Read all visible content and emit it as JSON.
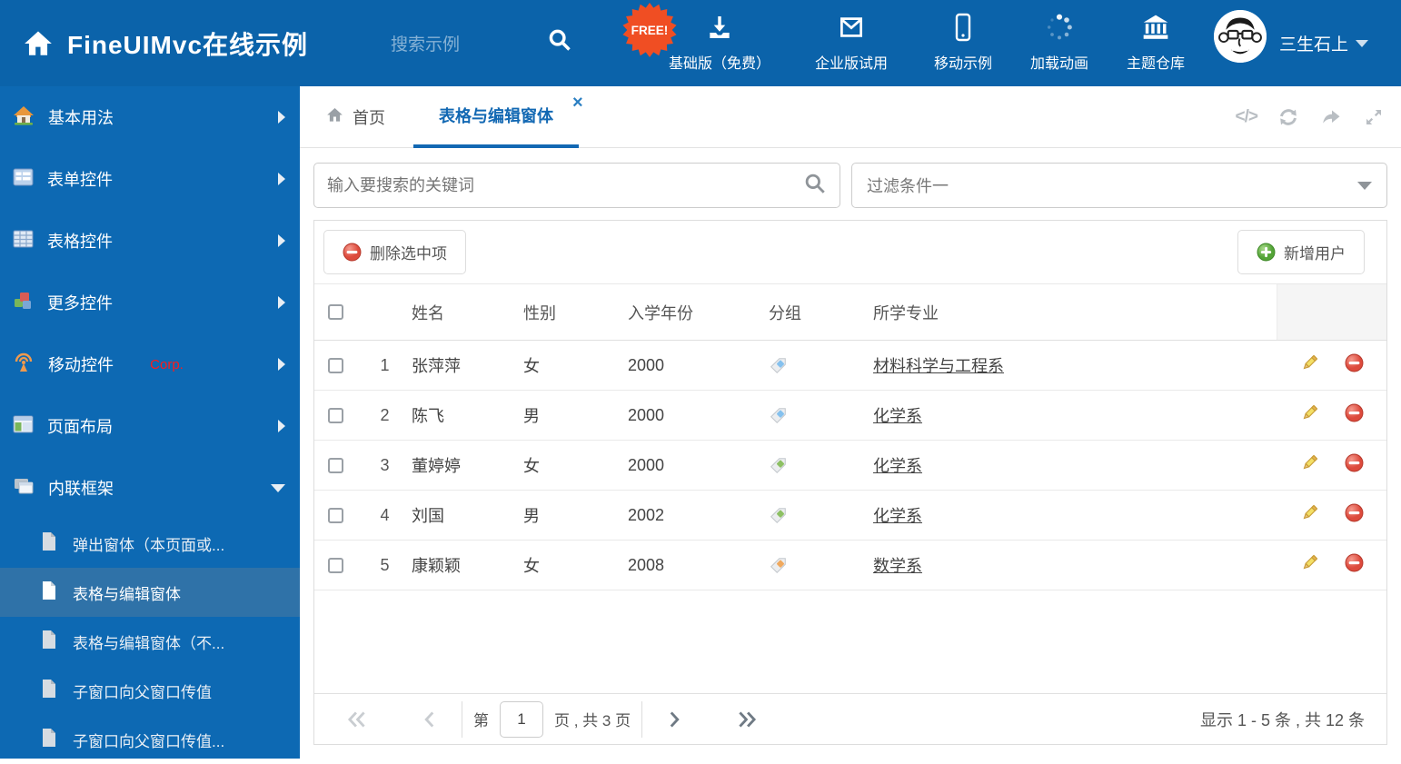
{
  "header": {
    "title": "FineUIMvc在线示例",
    "search_placeholder": "搜索示例",
    "free_badge": "FREE!",
    "nav_items": [
      {
        "label": "基础版（免费）",
        "icon": "download-icon"
      },
      {
        "label": "企业版试用",
        "icon": "mail-icon"
      },
      {
        "label": "移动示例",
        "icon": "phone-icon"
      },
      {
        "label": "加载动画",
        "icon": "spinner-icon"
      },
      {
        "label": "主题仓库",
        "icon": "bank-icon"
      }
    ],
    "username": "三生石上"
  },
  "sidebar": {
    "items": [
      {
        "label": "基本用法",
        "icon": "home-icon"
      },
      {
        "label": "表单控件",
        "icon": "form-icon"
      },
      {
        "label": "表格控件",
        "icon": "table-icon"
      },
      {
        "label": "更多控件",
        "icon": "cubes-icon"
      },
      {
        "label": "移动控件",
        "badge": "Corp.",
        "icon": "antenna-icon"
      },
      {
        "label": "页面布局",
        "icon": "layout-icon"
      },
      {
        "label": "内联框架",
        "icon": "frames-icon"
      }
    ],
    "subitems": [
      {
        "label": "弹出窗体（本页面或..."
      },
      {
        "label": "表格与编辑窗体"
      },
      {
        "label": "表格与编辑窗体（不..."
      },
      {
        "label": "子窗口向父窗口传值"
      },
      {
        "label": "子窗口向父窗口传值..."
      }
    ]
  },
  "tabs": {
    "home": "首页",
    "active": "表格与编辑窗体",
    "close": "×"
  },
  "content": {
    "search_placeholder": "输入要搜索的关键词",
    "filter_value": "过滤条件一",
    "delete_button": "删除选中项",
    "add_button": "新增用户",
    "table": {
      "headers": {
        "name": "姓名",
        "gender": "性别",
        "year": "入学年份",
        "group": "分组",
        "major": "所学专业"
      },
      "rows": [
        {
          "num": "1",
          "name": "张萍萍",
          "gender": "女",
          "year": "2000",
          "tag_color": "#85c1ee",
          "major": "材料科学与工程系"
        },
        {
          "num": "2",
          "name": "陈飞",
          "gender": "男",
          "year": "2000",
          "tag_color": "#85c1ee",
          "major": "化学系"
        },
        {
          "num": "3",
          "name": "董婷婷",
          "gender": "女",
          "year": "2000",
          "tag_color": "#8dc063",
          "major": "化学系"
        },
        {
          "num": "4",
          "name": "刘国",
          "gender": "男",
          "year": "2002",
          "tag_color": "#8dc063",
          "major": "化学系"
        },
        {
          "num": "5",
          "name": "康颖颖",
          "gender": "女",
          "year": "2008",
          "tag_color": "#f0a95e",
          "major": "数学系"
        }
      ]
    },
    "pagination": {
      "prefix": "第",
      "page_value": "1",
      "suffix": "页 , 共 3 页",
      "summary": "显示 1 - 5 条 , 共 12 条"
    }
  },
  "colors": {
    "header_blue": "#0b63aa",
    "sidebar_blue": "#0d69b3",
    "accent_blue": "#1268b3",
    "free_orange": "#f04e23"
  }
}
